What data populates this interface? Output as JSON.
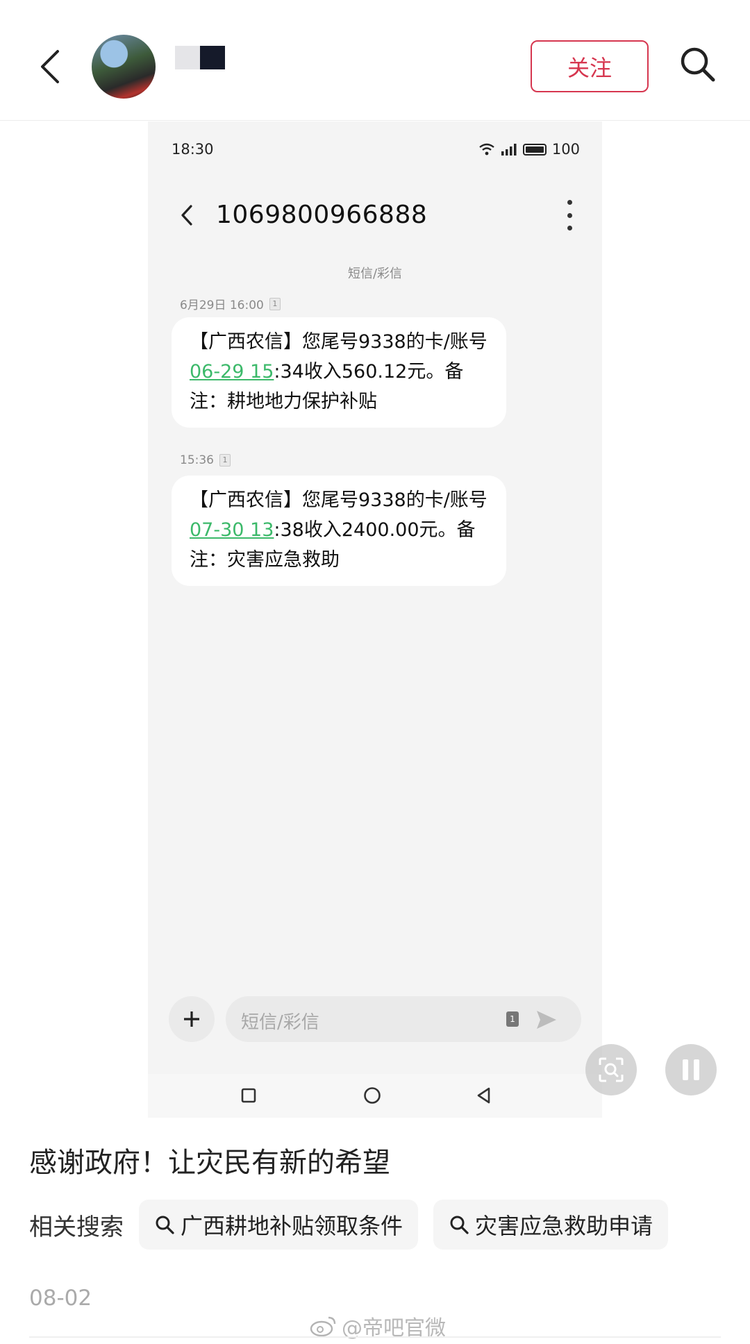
{
  "header": {
    "follow_label": "关注"
  },
  "phone": {
    "status": {
      "time": "18:30",
      "battery": "100"
    },
    "sms_header": {
      "sender_number": "1069800966888"
    },
    "channel_label": "短信/彩信",
    "messages": [
      {
        "timestamp": "6月29日 16:00",
        "sim": "1",
        "text_before": "【广西农信】您尾号9338的卡/账号",
        "link_text": "06-29 15",
        "text_after": ":34收入560.12元。备注：耕地地力保护补贴"
      },
      {
        "timestamp": "15:36",
        "sim": "1",
        "text_before": "【广西农信】您尾号9338的卡/账号",
        "link_text": "07-30 13",
        "text_after": ":38收入2400.00元。备注：灾害应急救助"
      }
    ],
    "input": {
      "placeholder": "短信/彩信",
      "sim": "1"
    }
  },
  "post": {
    "text": "感谢政府！让灾民有新的希望",
    "related_label": "相关搜索",
    "related_searches": [
      "广西耕地补贴领取条件",
      "灾害应急救助申请"
    ],
    "date": "08-02",
    "watermark": "@帝吧官微"
  },
  "colors": {
    "accent_red": "#d6364f",
    "link_green": "#3cb96a"
  },
  "icons": [
    "back-arrow-icon",
    "search-icon",
    "wifi-icon",
    "signal-icon",
    "battery-icon",
    "more-vertical-icon",
    "plus-icon",
    "send-icon",
    "nav-square-icon",
    "nav-circle-icon",
    "nav-triangle-icon",
    "screen-scan-icon",
    "pause-icon",
    "weibo-icon"
  ]
}
